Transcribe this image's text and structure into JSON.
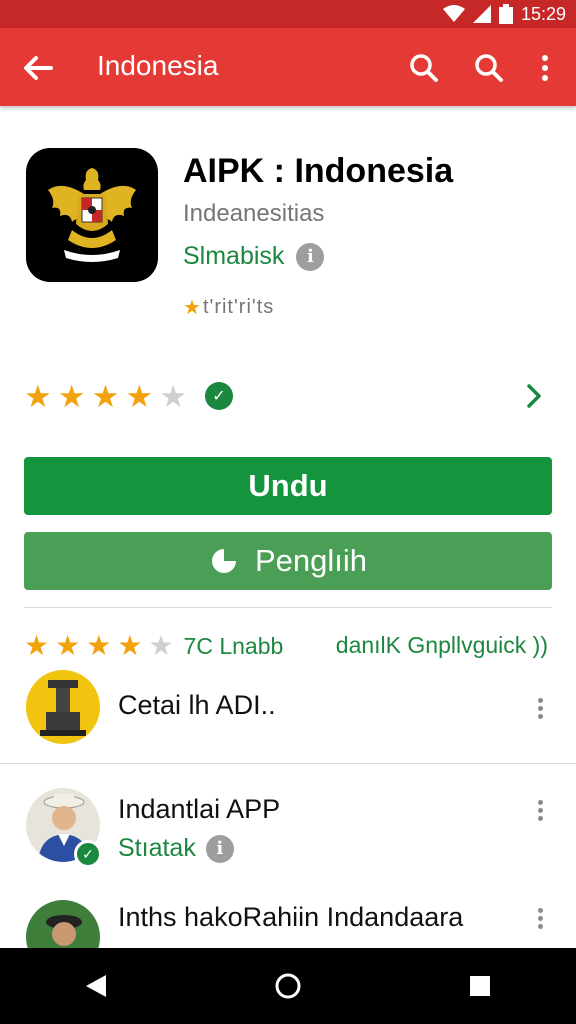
{
  "status_bar": {
    "time": "15:29",
    "icons": [
      "wifi-icon",
      "signal-icon",
      "battery-icon"
    ]
  },
  "app_bar": {
    "title": "Indonesia",
    "icons": [
      "arrow-back-icon",
      "search-icon",
      "search-icon",
      "more-vert-icon"
    ]
  },
  "app": {
    "title": "AIPK : Indonesia",
    "subtitle": "Indeanesitias",
    "developer": "Slmabisk",
    "small_rating_text": "t'rit'ri'ts"
  },
  "rating": {
    "stars_filled": 4,
    "stars_total": 5
  },
  "buttons": {
    "install_label": "Undu",
    "secondary_label": "Penglıih"
  },
  "reviews": {
    "stars_filled": 4,
    "stars_total": 5,
    "count_label": "7C Lnabb",
    "link_label": "danılK Gnpllvguick ))"
  },
  "items": [
    {
      "title": "Cetai lh ADI..",
      "subtitle": ""
    },
    {
      "title": "Indantlai APP",
      "subtitle": "Stıatak"
    },
    {
      "title": "Inths hakoRahiin Indandaara",
      "subtitle": ""
    }
  ],
  "colors": {
    "status_bar": "#c62828",
    "app_bar": "#e53935",
    "install_button": "#14943c",
    "secondary_button": "#4a9e55",
    "accent_green": "#1b873f",
    "star": "#f2a20d"
  },
  "nav": {
    "icons": [
      "back-triangle-icon",
      "home-circle-icon",
      "recents-square-icon"
    ]
  }
}
